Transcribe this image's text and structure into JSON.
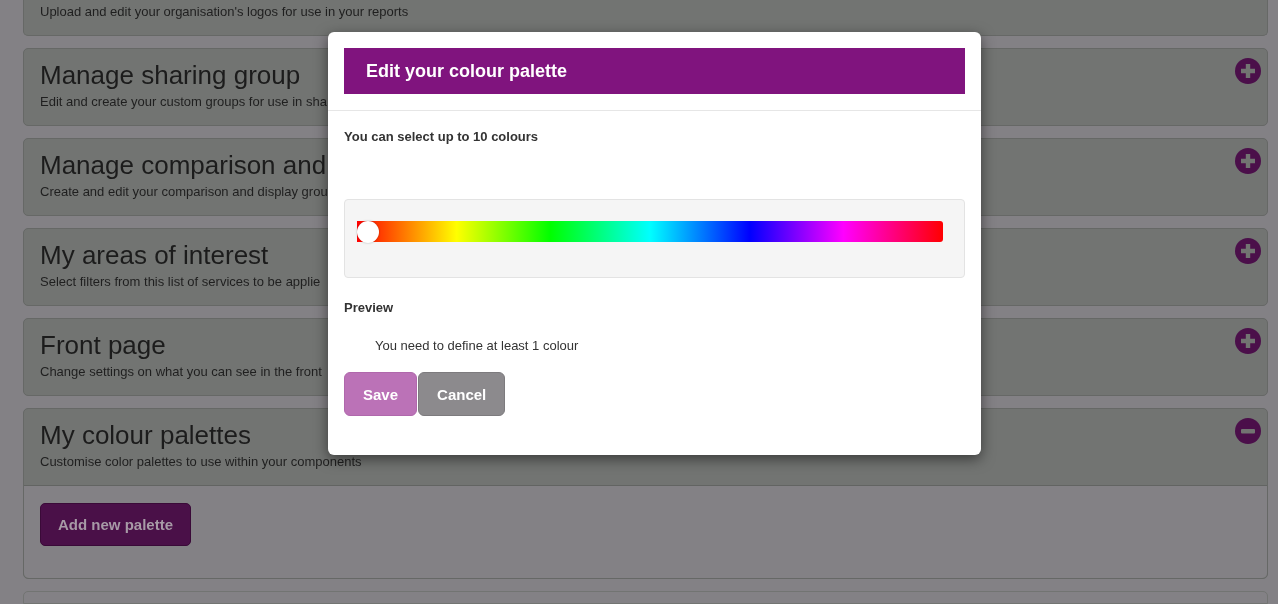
{
  "panels": [
    {
      "description": "Upload and edit your organisation's logos for use in your reports"
    },
    {
      "title": "Manage sharing group",
      "description": "Edit and create your custom groups for use in sha",
      "expanded": false
    },
    {
      "title": "Manage comparison and",
      "description": "Create and edit your comparison and display grou",
      "expanded": false
    },
    {
      "title": "My areas of interest",
      "description": "Select filters from this list of services to be applie",
      "expanded": false
    },
    {
      "title": "Front page",
      "description": "Change settings on what you can see in the front",
      "expanded": false
    },
    {
      "title": "My colour palettes",
      "description": "Customise color palettes to use within your components",
      "expanded": true,
      "action": "Add new palette"
    }
  ],
  "dialog": {
    "title": "Edit your colour palette",
    "hint": "You can select up to 10 colours",
    "hue_slider": {
      "level": 0
    },
    "preview_label": "Preview",
    "preview_message": "You need to define at least 1 colour",
    "buttons": [
      {
        "label": "Save",
        "kind": "primary",
        "disabled": true
      },
      {
        "label": "Cancel",
        "kind": "secondary",
        "disabled": false
      }
    ]
  }
}
